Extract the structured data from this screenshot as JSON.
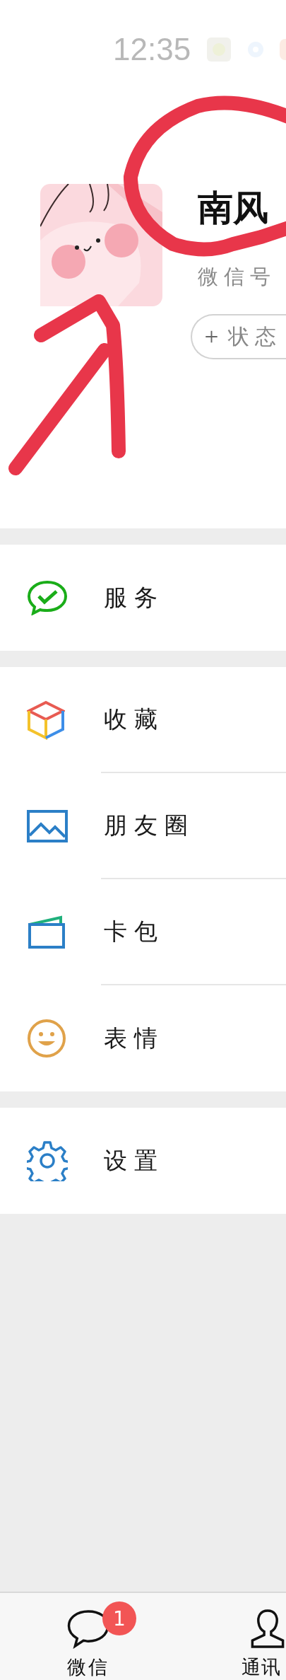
{
  "status_bar": {
    "time": "12:35"
  },
  "profile": {
    "name": "南风",
    "wechat_id_label": "微信号",
    "status_button": "状态"
  },
  "menu_groups": [
    {
      "items": [
        {
          "label": "服务",
          "kind": "pay"
        }
      ]
    },
    {
      "items": [
        {
          "label": "收藏",
          "kind": "favorites"
        },
        {
          "label": "朋友圈",
          "kind": "moments"
        },
        {
          "label": "卡包",
          "kind": "cards"
        },
        {
          "label": "表情",
          "kind": "stickers"
        }
      ]
    },
    {
      "items": [
        {
          "label": "设置",
          "kind": "settings"
        }
      ]
    }
  ],
  "tab_bar": [
    {
      "label": "微信",
      "kind": "chats",
      "badge": "1",
      "selected": false
    },
    {
      "label": "通讯",
      "kind": "contacts",
      "selected": false
    }
  ]
}
